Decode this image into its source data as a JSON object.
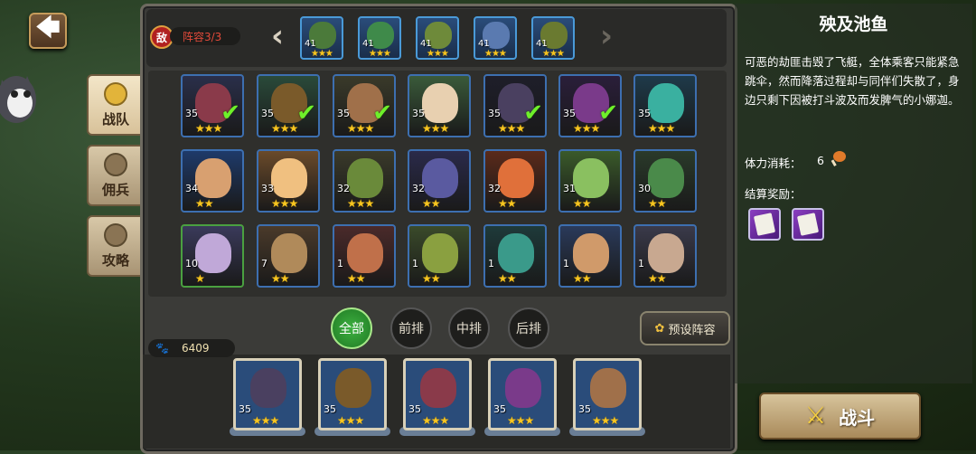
{
  "nav": {
    "back": "🡄"
  },
  "side_tabs": [
    {
      "label": "战队",
      "active": true
    },
    {
      "label": "佣兵",
      "active": false
    },
    {
      "label": "攻略",
      "active": false
    }
  ],
  "enemy": {
    "badge": "敌",
    "formation_label": "阵容3/3",
    "heroes": [
      {
        "level": "41",
        "stars": "★★★",
        "color": "#4b7a3a"
      },
      {
        "level": "41",
        "stars": "★★★",
        "color": "#3f8a4a"
      },
      {
        "level": "41",
        "stars": "★★★",
        "color": "#6e8a3a"
      },
      {
        "level": "41",
        "stars": "★★★",
        "color": "#5a7ab0"
      },
      {
        "level": "41",
        "stars": "★★★",
        "color": "#6a7a30"
      }
    ]
  },
  "roster": [
    {
      "level": "35",
      "stars": "★★★",
      "selected": true,
      "color": "#8a3a4a",
      "bg": "#2a2f4a"
    },
    {
      "level": "35",
      "stars": "★★★",
      "selected": true,
      "color": "#7a5a2a",
      "bg": "#2a4a3a"
    },
    {
      "level": "35",
      "stars": "★★★",
      "selected": true,
      "color": "#a0704a",
      "bg": "#3a3a2a"
    },
    {
      "level": "35",
      "stars": "★★★",
      "selected": false,
      "color": "#e8d0b0",
      "bg": "#3a5a3a"
    },
    {
      "level": "35",
      "stars": "★★★",
      "selected": true,
      "color": "#4a4060",
      "bg": "#1e1e2a"
    },
    {
      "level": "35",
      "stars": "★★★",
      "selected": true,
      "color": "#7a3a8a",
      "bg": "#2a1e3a"
    },
    {
      "level": "35",
      "stars": "★★★",
      "selected": false,
      "color": "#3ab0a0",
      "bg": "#1e3a4a"
    },
    {
      "level": "34",
      "stars": "★★",
      "selected": false,
      "color": "#d8a070",
      "bg": "#1e3a6a"
    },
    {
      "level": "33",
      "stars": "★★★",
      "selected": false,
      "color": "#f0c080",
      "bg": "#6a4a2a"
    },
    {
      "level": "32",
      "stars": "★★★",
      "selected": false,
      "color": "#6a8a3a",
      "bg": "#3a3a2a"
    },
    {
      "level": "32",
      "stars": "★★",
      "selected": false,
      "color": "#5a5aa0",
      "bg": "#2a2a4a"
    },
    {
      "level": "32",
      "stars": "★★",
      "selected": false,
      "color": "#e0703a",
      "bg": "#5a2a1a"
    },
    {
      "level": "31",
      "stars": "★★",
      "selected": false,
      "color": "#8ac060",
      "bg": "#3a5a2a"
    },
    {
      "level": "30",
      "stars": "★★",
      "selected": false,
      "color": "#4a8a4a",
      "bg": "#2a3a2a"
    },
    {
      "level": "10",
      "stars": "★",
      "selected": false,
      "color": "#c0a8d8",
      "bg": "#3a3a5a",
      "green": true
    },
    {
      "level": "7",
      "stars": "★★",
      "selected": false,
      "color": "#b08a5a",
      "bg": "#4a3a2a"
    },
    {
      "level": "1",
      "stars": "★★",
      "selected": false,
      "color": "#c0704a",
      "bg": "#4a2a2a"
    },
    {
      "level": "1",
      "stars": "★★",
      "selected": false,
      "color": "#8aa040",
      "bg": "#3a4a2a"
    },
    {
      "level": "1",
      "stars": "★★",
      "selected": false,
      "color": "#3a9a8a",
      "bg": "#1e3a3a"
    },
    {
      "level": "1",
      "stars": "★★",
      "selected": false,
      "color": "#d09a6a",
      "bg": "#2a3a5a"
    },
    {
      "level": "1",
      "stars": "★★",
      "selected": false,
      "color": "#c8a890",
      "bg": "#3a3a4a"
    }
  ],
  "filters": [
    {
      "label": "全部",
      "active": true
    },
    {
      "label": "前排",
      "active": false
    },
    {
      "label": "中排",
      "active": false
    },
    {
      "label": "后排",
      "active": false
    }
  ],
  "preset_label": "预设阵容",
  "power": "6409",
  "team": [
    {
      "level": "35",
      "stars": "★★★",
      "color": "#4a4060"
    },
    {
      "level": "35",
      "stars": "★★★",
      "color": "#7a5a2a"
    },
    {
      "level": "35",
      "stars": "★★★",
      "color": "#8a3a4a"
    },
    {
      "level": "35",
      "stars": "★★★",
      "color": "#7a3a8a"
    },
    {
      "level": "35",
      "stars": "★★★",
      "color": "#a0704a"
    }
  ],
  "stage": {
    "title": "殃及池鱼",
    "description": "可恶的劫匪击毁了飞艇，全体乘客只能紧急跳伞，然而降落过程却与同伴们失散了，身边只剩下因被打斗波及而发脾气的小娜迦。",
    "cost_label": "体力消耗：",
    "cost_value": "6",
    "reward_label": "结算奖励：",
    "fight_label": "战斗"
  },
  "colors": {
    "accent_green": "#3db040",
    "enemy_red": "#e24a3a",
    "star": "#f7c520"
  }
}
